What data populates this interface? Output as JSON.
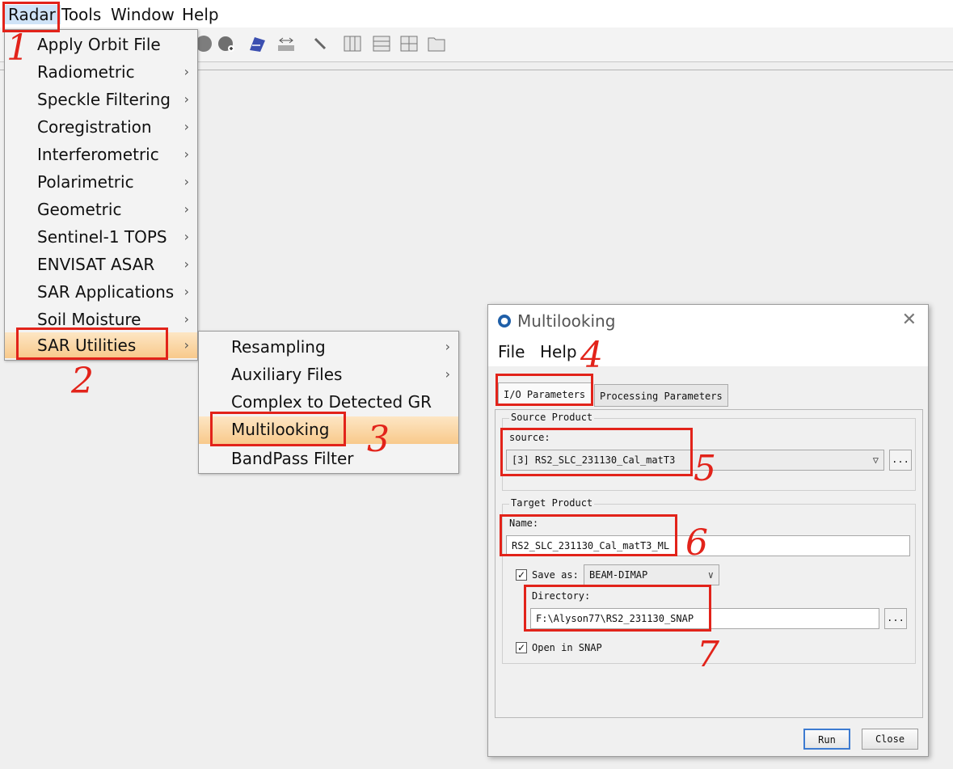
{
  "menubar": {
    "items": [
      "Radar",
      "Tools",
      "Window",
      "Help"
    ]
  },
  "radar_menu": {
    "items": [
      {
        "label": "Apply Orbit File",
        "submenu": false
      },
      {
        "label": "Radiometric",
        "submenu": true
      },
      {
        "label": "Speckle Filtering",
        "submenu": true
      },
      {
        "label": "Coregistration",
        "submenu": true
      },
      {
        "label": "Interferometric",
        "submenu": true
      },
      {
        "label": "Polarimetric",
        "submenu": true
      },
      {
        "label": "Geometric",
        "submenu": true
      },
      {
        "label": "Sentinel-1 TOPS",
        "submenu": true
      },
      {
        "label": "ENVISAT ASAR",
        "submenu": true
      },
      {
        "label": "SAR Applications",
        "submenu": true
      },
      {
        "label": "Soil Moisture",
        "submenu": true
      },
      {
        "label": "SAR Utilities",
        "submenu": true,
        "highlighted": true
      }
    ]
  },
  "sar_utilities_menu": {
    "items": [
      {
        "label": "Resampling",
        "submenu": true
      },
      {
        "label": "Auxiliary Files",
        "submenu": true
      },
      {
        "label": "Complex to Detected GR",
        "submenu": false
      },
      {
        "label": "Multilooking",
        "submenu": false,
        "highlighted": true
      },
      {
        "label": "BandPass Filter",
        "submenu": false
      }
    ]
  },
  "arrow_glyph": "›",
  "dialog": {
    "title": "Multilooking",
    "close_glyph": "✕",
    "menu": [
      "File",
      "Help"
    ],
    "tabs": [
      "I/O Parameters",
      "Processing Parameters"
    ],
    "source_group": {
      "title": "Source Product",
      "label": "source:",
      "value": "[3] RS2_SLC_231130_Cal_matT3"
    },
    "target_group": {
      "title": "Target Product",
      "name_label": "Name:",
      "name_value": "RS2_SLC_231130_Cal_matT3_ML",
      "save_as_label": "Save as:",
      "save_as_checked": true,
      "format": "BEAM-DIMAP",
      "directory_label": "Directory:",
      "directory_value": "F:\\Alyson77\\RS2_231130_SNAP",
      "open_in_snap_label": "Open in SNAP",
      "open_in_snap_checked": true
    },
    "browse_label": "...",
    "run_label": "Run",
    "close_label": "Close"
  },
  "annotations": [
    "1",
    "2",
    "3",
    "4",
    "5",
    "6",
    "7"
  ],
  "colors": {
    "annotation_red": "#e2231a",
    "highlight_orange": "#f8c98b",
    "menu_select_blue": "#cfe3f7"
  }
}
